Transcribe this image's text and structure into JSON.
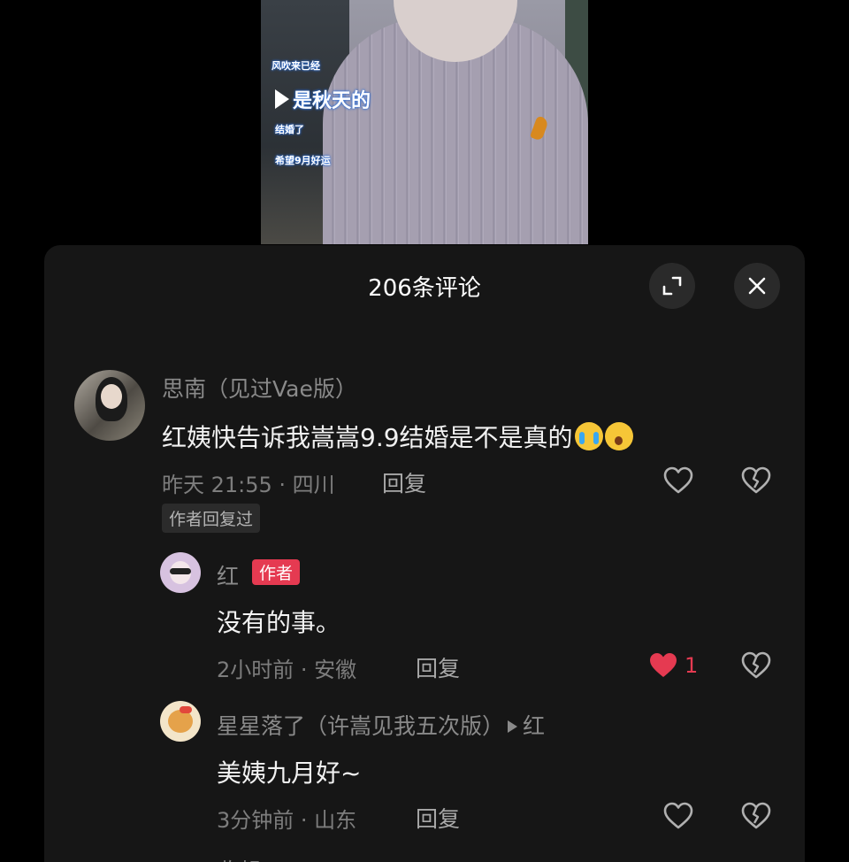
{
  "video": {
    "caption_line1": "风吹来已经",
    "caption_line2": "是秋天的",
    "caption_line3": "结婚了",
    "caption_line4": "希望9月好运"
  },
  "panel": {
    "title": "206条评论",
    "expand_icon": "expand-icon",
    "close_icon": "close-icon"
  },
  "comments": [
    {
      "username": "思南（见过Vae版）",
      "text": "红姨快告诉我嵩嵩9.9结婚是不是真的",
      "emojis": [
        "loudly-crying-face",
        "astonished-face"
      ],
      "time": "昨天 21:55 · 四川",
      "reply_label": "回复",
      "tag": "作者回复过",
      "liked": false
    }
  ],
  "replies": [
    {
      "username": "红",
      "badge": "作者",
      "text": "没有的事。",
      "time": "2小时前 · 安徽",
      "reply_label": "回复",
      "like_count": "1",
      "liked": true,
      "like_color": "#e53a51"
    },
    {
      "username": "星星落了（许嵩见我五次版）",
      "reply_to": "红",
      "text": "美姨九月好~",
      "time": "3分钟前 · 山东",
      "reply_label": "回复",
      "liked": false
    }
  ],
  "footer": {
    "collapse_label": "收起"
  },
  "colors": {
    "accent": "#e53a51",
    "panel_bg": "#161616"
  }
}
